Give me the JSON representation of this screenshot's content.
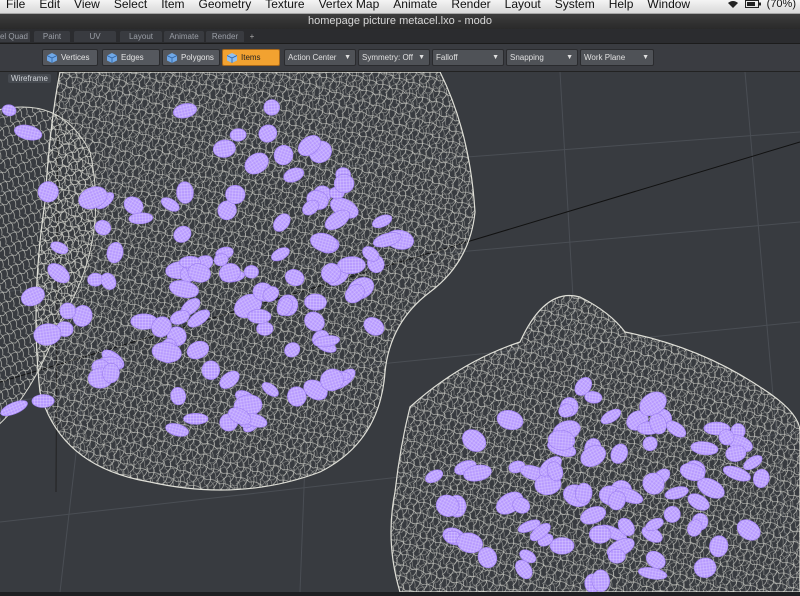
{
  "menubar": {
    "items": [
      "File",
      "Edit",
      "View",
      "Select",
      "Item",
      "Geometry",
      "Texture",
      "Vertex Map",
      "Animate",
      "Render",
      "Layout",
      "System",
      "Help",
      "Window"
    ],
    "battery": "(70%)"
  },
  "window": {
    "title": "homepage picture metacel.lxo - modo"
  },
  "layout_tabs": [
    "el Quad",
    "Paint",
    "UV",
    "Layout",
    "Animate",
    "Render",
    "+"
  ],
  "toolbar": {
    "modes": [
      "Vertices",
      "Edges",
      "Polygons",
      "Items"
    ],
    "active_mode": "Items",
    "dropdowns": [
      "Action Center",
      "Symmetry: Off",
      "Falloff",
      "Snapping",
      "Work Plane"
    ]
  },
  "viewport": {
    "label": "Wireframe"
  },
  "colors": {
    "accent": "#f2a230",
    "wire": "#d8d8d0",
    "nucleus": "#b79aff",
    "viewport_bg": "#383b40"
  },
  "icons": {
    "mode_icon": "cube-icon",
    "dropdown": "chevron-down-icon"
  }
}
